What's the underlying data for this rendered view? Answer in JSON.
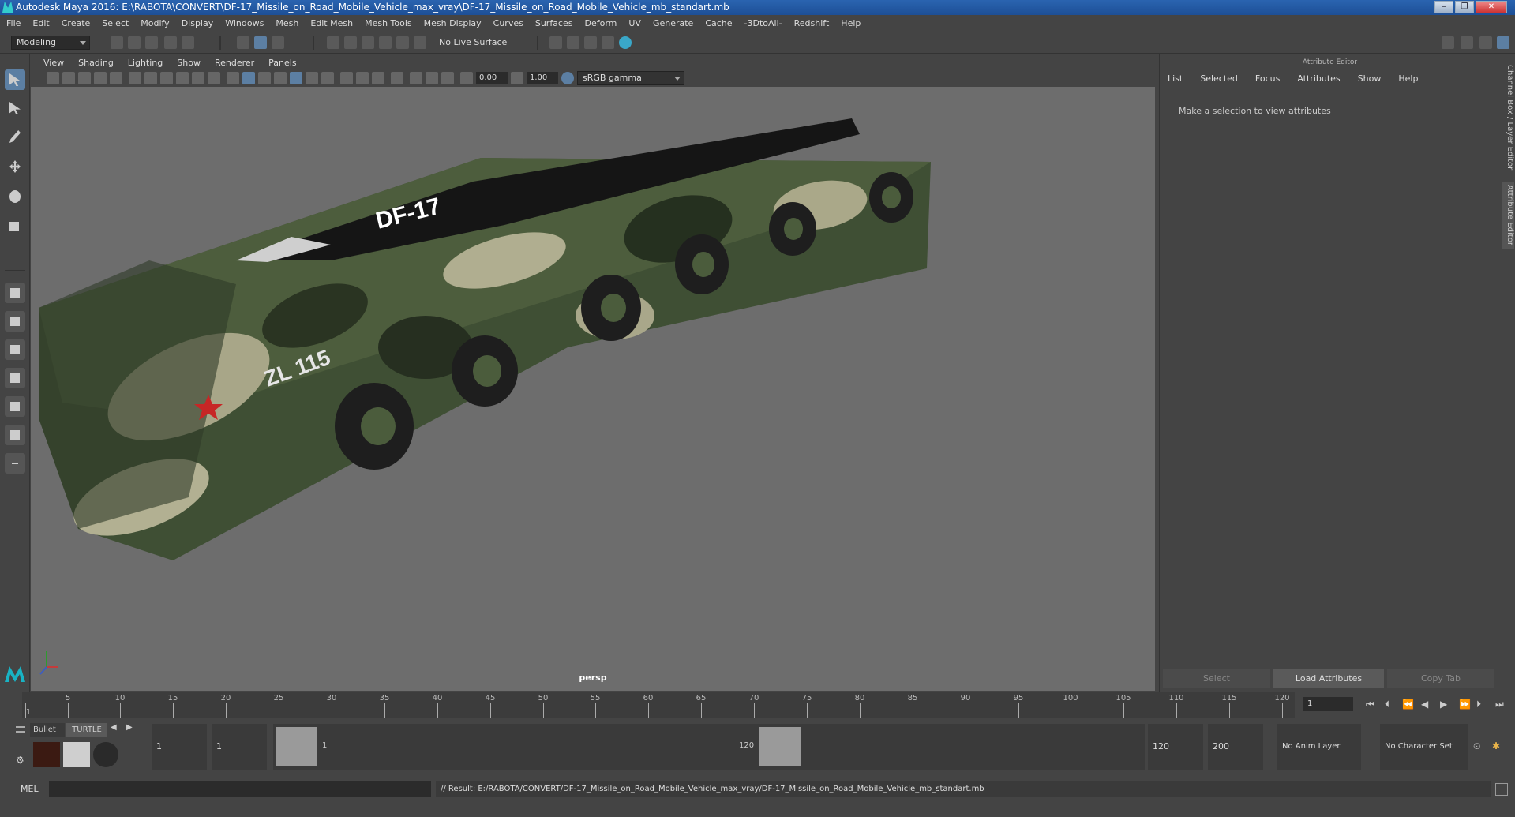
{
  "window": {
    "title": "Autodesk Maya 2016: E:\\RABOTA\\CONVERT\\DF-17_Missile_on_Road_Mobile_Vehicle_max_vray\\DF-17_Missile_on_Road_Mobile_Vehicle_mb_standart.mb",
    "minimize": "–",
    "maximize": "❐",
    "close": "✕"
  },
  "menubar": [
    "File",
    "Edit",
    "Create",
    "Select",
    "Modify",
    "Display",
    "Windows",
    "Mesh",
    "Edit Mesh",
    "Mesh Tools",
    "Mesh Display",
    "Curves",
    "Surfaces",
    "Deform",
    "UV",
    "Generate",
    "Cache",
    "-3DtoAll-",
    "Redshift",
    "Help"
  ],
  "statusline": {
    "mode": "Modeling",
    "live_surface": "No Live Surface"
  },
  "panel": {
    "menu": [
      "View",
      "Shading",
      "Lighting",
      "Show",
      "Renderer",
      "Panels"
    ],
    "exposure": "0.00",
    "gamma": "1.00",
    "color_space": "sRGB gamma",
    "camera_label": "persp"
  },
  "model": {
    "missile_text": "DF-17",
    "vehicle_text": "ZL 115"
  },
  "attribute_editor": {
    "title": "Attribute Editor",
    "menu": [
      "List",
      "Selected",
      "Focus",
      "Attributes",
      "Show",
      "Help"
    ],
    "hint": "Make a selection to view attributes",
    "buttons": {
      "select": "Select",
      "load": "Load Attributes",
      "copy": "Copy Tab"
    },
    "side_tabs": [
      "Channel Box / Layer Editor",
      "Attribute Editor"
    ]
  },
  "timeline": {
    "ticks": [
      "1",
      "5",
      "10",
      "15",
      "20",
      "25",
      "30",
      "35",
      "40",
      "45",
      "50",
      "55",
      "60",
      "65",
      "70",
      "75",
      "80",
      "85",
      "90",
      "95",
      "100",
      "105",
      "110",
      "115",
      "120"
    ],
    "current_frame": "1"
  },
  "range": {
    "shelf_tabs": [
      "Bullet",
      "TURTLE"
    ],
    "start": "1",
    "playback_start": "1",
    "range_start_label": "1",
    "range_end_label": "120",
    "playback_end": "120",
    "end": "200",
    "anim_layer": "No Anim Layer",
    "character_set": "No Character Set"
  },
  "command": {
    "lang": "MEL",
    "result": "// Result: E:/RABOTA/CONVERT/DF-17_Missile_on_Road_Mobile_Vehicle_max_vray/DF-17_Missile_on_Road_Mobile_Vehicle_mb_standart.mb"
  },
  "colors": {
    "viewport_bg": "#6d6d6d",
    "accent": "#5c7fa3",
    "title_bar": "#1d4f96"
  }
}
